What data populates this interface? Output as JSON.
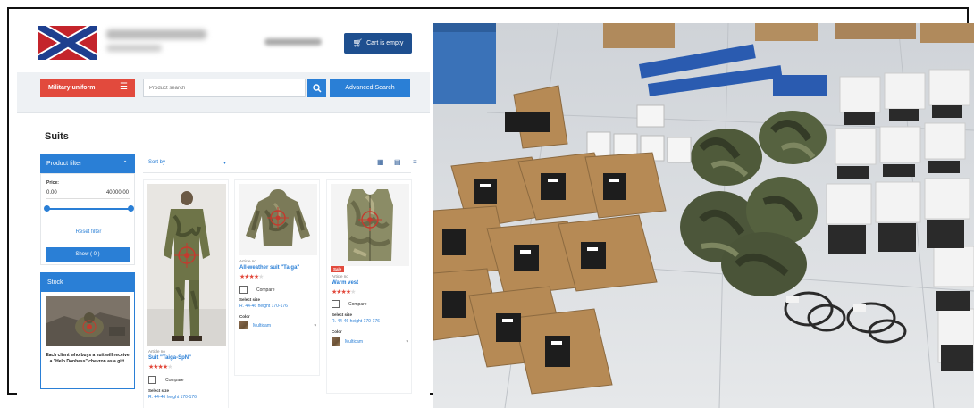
{
  "header": {
    "cart_label": "Cart is empty"
  },
  "nav": {
    "category_label": "Military uniform",
    "search_placeholder": "Product search",
    "advanced_search_label": "Advanced Search"
  },
  "page": {
    "title": "Suits"
  },
  "filter": {
    "title": "Product filter",
    "price_label": "Price:",
    "price_min": "0.00",
    "price_max": "40000.00",
    "range_low_fraction": 0.0,
    "range_high_fraction": 1.0,
    "reset_label": "Reset filter",
    "show_label": "Show ( 0 )"
  },
  "stock": {
    "title": "Stock",
    "text": "Each client who buys a suit will receive a \"Help Donbass\" chevron as a gift."
  },
  "sort": {
    "label": "Sort by"
  },
  "products": [
    {
      "article": "Article no",
      "title": "Suit \"Taiga-SpN\"",
      "rating": 4,
      "compare_label": "Compare",
      "size_label": "Select size",
      "size_value": "R. 44-46 height 170-176",
      "sale": false
    },
    {
      "article": "Article no",
      "title": "All-weather suit \"Taiga\"",
      "rating": 4,
      "compare_label": "Compare",
      "size_label": "Select size",
      "size_value": "R. 44-46 height 170-176",
      "color_label": "Color",
      "color_value": "Multicam",
      "sale": false
    },
    {
      "article": "Article no",
      "title": "Warm vest",
      "rating": 4,
      "compare_label": "Compare",
      "size_label": "Select size",
      "size_value": "R. 44-46 height 170-176",
      "color_label": "Color",
      "color_value": "Multicam",
      "sale": true,
      "sale_label": "Sale"
    }
  ],
  "colors": {
    "brand_blue": "#2a7fd6",
    "dark_blue": "#1e4f8f",
    "accent_red": "#e24a3d",
    "flag_red": "#c4242b"
  }
}
